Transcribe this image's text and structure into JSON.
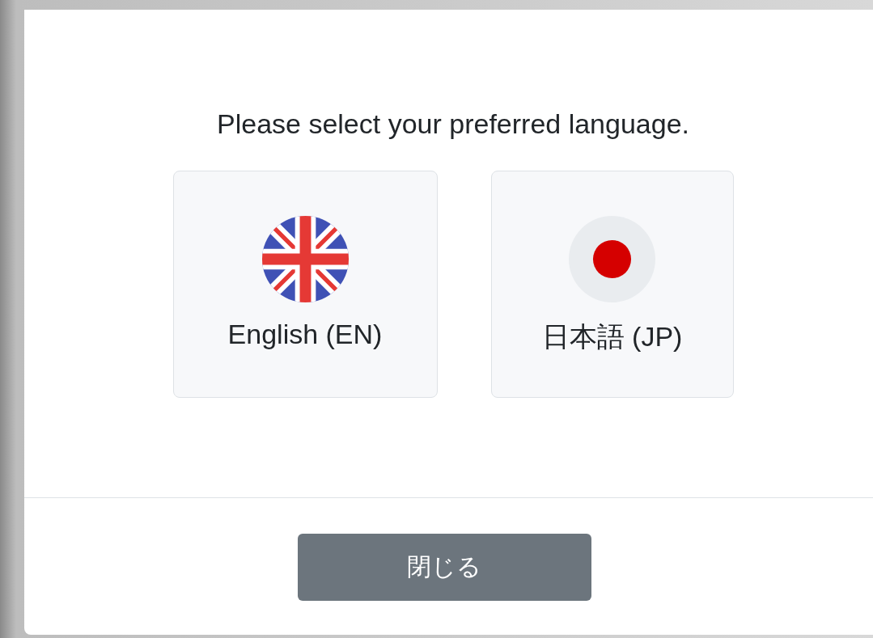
{
  "dialog": {
    "prompt": "Please select your preferred language.",
    "languages": [
      {
        "label": "English (EN)",
        "kind": "uk"
      },
      {
        "label": "日本語 (JP)",
        "kind": "jp"
      }
    ],
    "close_button": "閉じる"
  }
}
